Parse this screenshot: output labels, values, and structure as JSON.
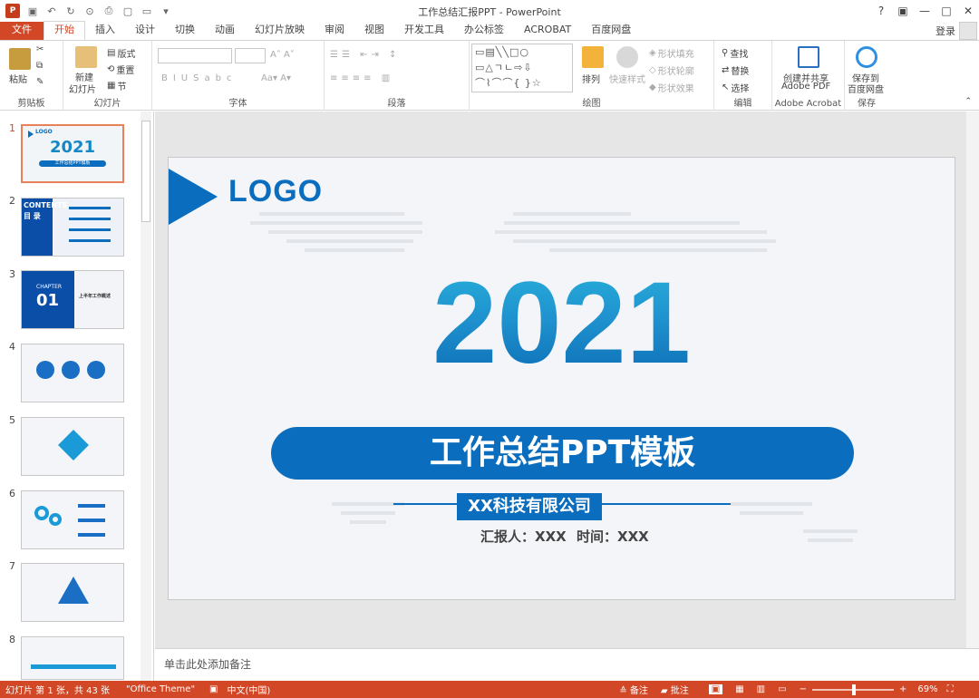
{
  "app": {
    "window_title": "工作总结汇报PPT - PowerPoint",
    "login": "登录"
  },
  "tabs": [
    {
      "label": "文件"
    },
    {
      "label": "开始"
    },
    {
      "label": "插入"
    },
    {
      "label": "设计"
    },
    {
      "label": "切换"
    },
    {
      "label": "动画"
    },
    {
      "label": "幻灯片放映"
    },
    {
      "label": "审阅"
    },
    {
      "label": "视图"
    },
    {
      "label": "开发工具"
    },
    {
      "label": "办公标签"
    },
    {
      "label": "ACROBAT"
    },
    {
      "label": "百度网盘"
    }
  ],
  "ribbon": {
    "groups": {
      "clipboard": "剪贴板",
      "slides": "幻灯片",
      "font": "字体",
      "paragraph": "段落",
      "drawing": "绘图",
      "editing": "编辑",
      "acrobat": "Adobe Acrobat",
      "save": "保存"
    },
    "paste": "粘贴",
    "new_slide_l1": "新建",
    "new_slide_l2": "幻灯片",
    "layout": "版式",
    "reset": "重置",
    "section": "节",
    "arrange": "排列",
    "quick_styles": "快速样式",
    "shape_fill": "形状填充",
    "shape_outline": "形状轮廓",
    "shape_effects": "形状效果",
    "find": "查找",
    "replace": "替换",
    "select": "选择",
    "create_pdf_l1": "创建并共享",
    "create_pdf_l2": "Adobe PDF",
    "save_baidu_l1": "保存到",
    "save_baidu_l2": "百度网盘",
    "shape_glyphs_1": "▭▤╲╲□○",
    "shape_glyphs_2": "▭△ㄱㄴ⇨⇩",
    "shape_glyphs_3": "⌒⌇⌒⌒{ }☆"
  },
  "thumbs": [
    {
      "num": "1",
      "t1": "LOGO",
      "t2": "2021",
      "t3": "工作总结PPT模板"
    },
    {
      "num": "2",
      "t1": "CONTENTS",
      "t2": "目 录"
    },
    {
      "num": "3",
      "t1": "CHAPTER",
      "t2": "01",
      "t3": "上半年工作概述"
    },
    {
      "num": "4"
    },
    {
      "num": "5"
    },
    {
      "num": "6"
    },
    {
      "num": "7"
    },
    {
      "num": "8"
    }
  ],
  "slide": {
    "logo": "LOGO",
    "year": "2021",
    "title": "工作总结PPT模板",
    "company": "XX科技有限公司",
    "reporter": "汇报人：XXX",
    "time": "时间：XXX"
  },
  "notes": {
    "placeholder": "单击此处添加备注"
  },
  "status": {
    "slide_info": "幻灯片 第 1 张，共 43 张",
    "theme": "\"Office Theme\"",
    "language": "中文(中国)",
    "notes_btn": "备注",
    "comments_btn": "批注",
    "zoom": "69%"
  },
  "colors": {
    "accent": "#d24726",
    "slide_blue": "#0a6dbd"
  }
}
